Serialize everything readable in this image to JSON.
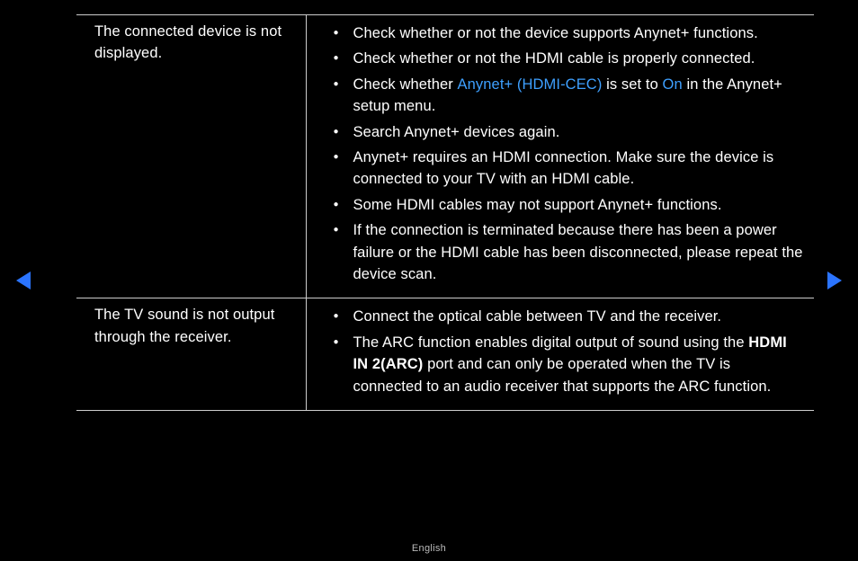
{
  "rows": [
    {
      "issue": "The connected device is not displayed.",
      "items": [
        {
          "segs": [
            {
              "t": "Check whether or not the device supports Anynet+ functions."
            }
          ]
        },
        {
          "segs": [
            {
              "t": "Check whether or not the HDMI cable is properly connected."
            }
          ]
        },
        {
          "segs": [
            {
              "t": "Check whether "
            },
            {
              "t": "Anynet+ (HDMI-CEC)",
              "cls": "hl"
            },
            {
              "t": " is set to "
            },
            {
              "t": "On",
              "cls": "hl"
            },
            {
              "t": " in the Anynet+ setup menu."
            }
          ]
        },
        {
          "segs": [
            {
              "t": "Search Anynet+ devices again."
            }
          ]
        },
        {
          "segs": [
            {
              "t": "Anynet+ requires an HDMI connection. Make sure the device is connected to your TV with an HDMI cable."
            }
          ]
        },
        {
          "segs": [
            {
              "t": "Some HDMI cables may not support Anynet+ functions."
            }
          ]
        },
        {
          "segs": [
            {
              "t": "If the connection is terminated because there has been a power failure or the HDMI cable has been disconnected, please repeat the device scan."
            }
          ]
        }
      ]
    },
    {
      "issue": "The TV sound is not output through the receiver.",
      "items": [
        {
          "segs": [
            {
              "t": "Connect the optical cable between TV and the receiver."
            }
          ]
        },
        {
          "segs": [
            {
              "t": "The ARC function enables digital output of sound using the "
            },
            {
              "t": "HDMI IN 2(ARC)",
              "cls": "b"
            },
            {
              "t": " port and can only be operated when the TV is connected to an audio receiver that supports the ARC function."
            }
          ]
        }
      ]
    }
  ],
  "footer": "English"
}
